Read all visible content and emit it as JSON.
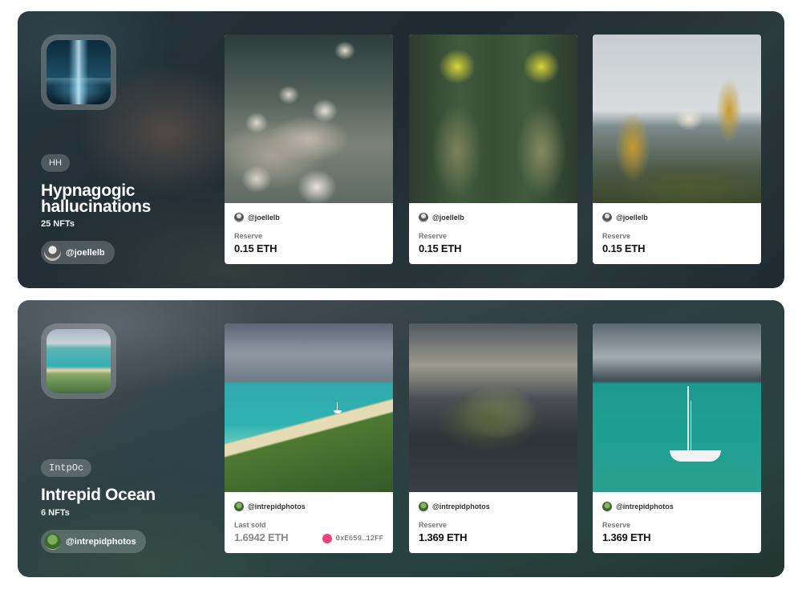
{
  "collections": [
    {
      "badge": "HH",
      "title": "Hypnagogic hallucinations",
      "count": "25 NFTs",
      "owner": "@joellelb",
      "thumb_icon": "glowing-cave-thumbnail",
      "cards": [
        {
          "creator": "@joellelb",
          "label": "Reserve",
          "price": "0.15 ETH",
          "art": "pale-figures-artwork"
        },
        {
          "creator": "@joellelb",
          "label": "Reserve",
          "price": "0.15 ETH",
          "art": "yellow-hooded-figures-artwork"
        },
        {
          "creator": "@joellelb",
          "label": "Reserve",
          "price": "0.15 ETH",
          "art": "golden-robed-figures-artwork"
        }
      ]
    },
    {
      "badge": "IntpOc",
      "title": "Intrepid Ocean",
      "count": "6 NFTs",
      "owner": "@intrepidphotos",
      "thumb_icon": "ocean-coast-thumbnail",
      "cards": [
        {
          "creator": "@intrepidphotos",
          "label": "Last sold",
          "price": "1.6942 ETH",
          "buyer": "0xE659…12FF",
          "art": "coastline-sailboat-photo"
        },
        {
          "creator": "@intrepidphotos",
          "label": "Reserve",
          "price": "1.369 ETH",
          "art": "rocky-island-photo"
        },
        {
          "creator": "@intrepidphotos",
          "label": "Reserve",
          "price": "1.369 ETH",
          "art": "catamaran-sea-photo"
        }
      ]
    }
  ],
  "colors": {
    "buyer_dot": "#e8427f",
    "card_bg": "#ffffff",
    "text_dark": "#111111"
  }
}
